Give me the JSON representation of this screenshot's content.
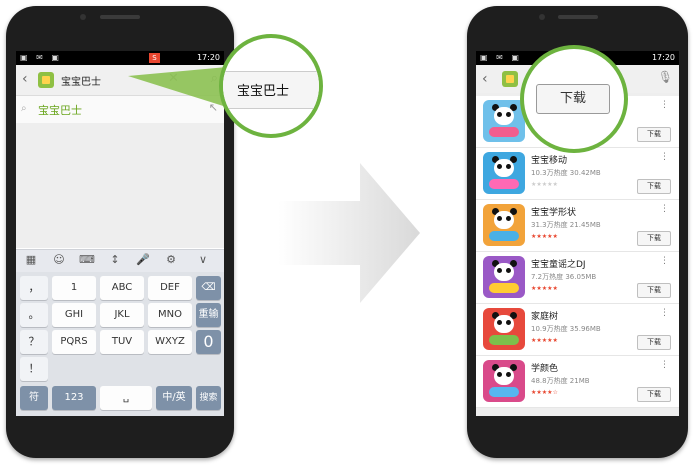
{
  "left_phone": {
    "status": {
      "time": "17:20",
      "icons": "▣ ✉ ▣",
      "badge": "S"
    },
    "search": {
      "query": "宝宝巴士",
      "clear_icon": "close-icon",
      "go_icon": "search-icon"
    },
    "suggestion": "宝宝巴士",
    "toolbar": [
      "▦",
      "☺",
      "⌨",
      "↕",
      "🎤",
      "⚙",
      "∨"
    ],
    "keyboard": {
      "side_keys": [
        "，",
        "。",
        "？",
        "！"
      ],
      "row1": [
        "1",
        "ABC",
        "DEF"
      ],
      "row2": [
        "GHI",
        "JKL",
        "MNO"
      ],
      "row3": [
        "PQRS",
        "TUV",
        "WXYZ"
      ],
      "backspace": "⌫",
      "enter": "重输",
      "zero": "0",
      "bottom": {
        "symbol": "符",
        "num": "123",
        "space": "␣",
        "lang": "中/英",
        "search": "搜索"
      }
    }
  },
  "zoom_left": {
    "text": "宝宝巴士"
  },
  "zoom_right": {
    "button": "下载"
  },
  "right_phone": {
    "status": {
      "time": "17:20",
      "icons": "▣ ✉ ▣"
    },
    "apps": [
      {
        "name": "",
        "meta": "",
        "button": "下载",
        "stars": "",
        "color": "#6fc0ea"
      },
      {
        "name": "宝宝移动",
        "meta": "10.3万热度     30.42MB",
        "button": "下载",
        "stars": "★★★★★",
        "color": "#3ea7e0"
      },
      {
        "name": "宝宝学形状",
        "meta": "31.3万热度     21.45MB",
        "button": "下载",
        "stars": "★★★★★",
        "color": "#f2a33a"
      },
      {
        "name": "宝宝童谣之DJ",
        "meta": "7.2万热度     36.05MB",
        "button": "下载",
        "stars": "★★★★★",
        "color": "#9a59c6"
      },
      {
        "name": "家庭树",
        "meta": "10.9万热度     35.96MB",
        "button": "下载",
        "stars": "★★★★★",
        "color": "#e7493c"
      },
      {
        "name": "学颜色",
        "meta": "48.8万热度     21MB",
        "button": "下载",
        "stars": "★★★★☆",
        "color": "#d94a8a"
      }
    ]
  }
}
